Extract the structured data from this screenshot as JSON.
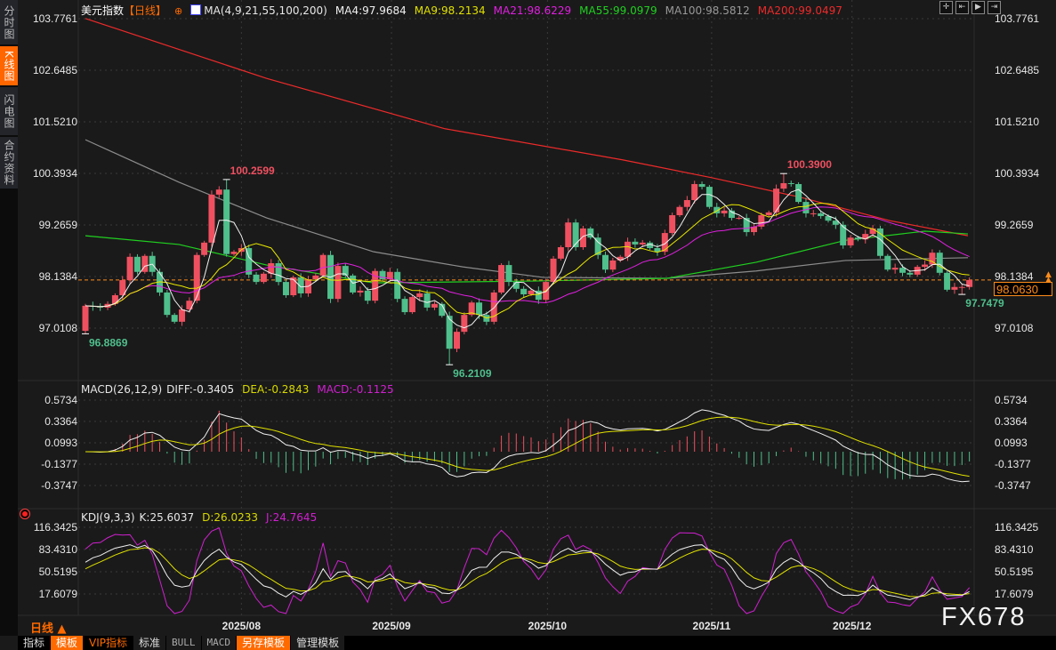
{
  "sidebar": {
    "tabs": [
      {
        "label": "分时图",
        "active": false
      },
      {
        "label": "K线图",
        "active": true
      },
      {
        "label": "闪电图",
        "active": false
      },
      {
        "label": "合约资料",
        "active": false
      }
    ]
  },
  "header": {
    "title": "美元指数",
    "period": "【日线】",
    "ma_params": "MA(4,9,21,55,100,200)",
    "ma4": "MA4:97.9684",
    "ma9": "MA9:98.2134",
    "ma21": "MA21:98.6229",
    "ma55": "MA55:99.0979",
    "ma100": "MA100:98.5812",
    "ma200": "MA200:99.0497"
  },
  "toolbar_icons": [
    "crosshair-icon",
    "zoom-start-icon",
    "play-forward-icon",
    "jump-end-icon"
  ],
  "macd_header": {
    "params": "MACD(26,12,9)",
    "diff": "DIFF:-0.3405",
    "dea": "DEA:-0.2843",
    "macd": "MACD:-0.1125"
  },
  "kdj_header": {
    "params": "KDJ(9,3,3)",
    "k": "K:25.6037",
    "d": "D:26.0233",
    "j": "J:24.7645"
  },
  "current_price": "98.0630",
  "daily_label": "日线 ▲",
  "watermark": "FX678",
  "bottom_toolbar": [
    {
      "label": "指标",
      "style": "black"
    },
    {
      "label": "模板",
      "style": "orange"
    },
    {
      "label": "VIP指标",
      "style": "vip"
    },
    {
      "label": "标准",
      "style": ""
    },
    {
      "label": "BULL",
      "style": "mono"
    },
    {
      "label": "MACD",
      "style": "mono"
    },
    {
      "label": "另存模板",
      "style": "orange"
    },
    {
      "label": "管理模板",
      "style": ""
    }
  ],
  "colors": {
    "up": "#ef5060",
    "down": "#4fbf8c",
    "ma4": "#f0f0f0",
    "ma9": "#e8e800",
    "ma21": "#e020e0",
    "ma55": "#20d020",
    "ma100": "#8c8c8c",
    "ma200": "#ee2a2a",
    "accent": "#ff6a00",
    "background": "#1a1a1a"
  },
  "chart_data": {
    "type": "candlestick",
    "price_axis": {
      "ticks": [
        "103.7761",
        "102.6485",
        "101.5210",
        "100.3934",
        "99.2659",
        "98.1384",
        "97.0108"
      ],
      "range": [
        96.1,
        103.8
      ]
    },
    "macd_axis": {
      "ticks": [
        "0.5734",
        "0.3364",
        "0.0993",
        "-0.1377",
        "-0.3747"
      ]
    },
    "kdj_axis": {
      "ticks": [
        "116.3425",
        "83.4310",
        "50.5195",
        "17.6079"
      ]
    },
    "x_ticks": [
      {
        "label": "2025/08",
        "index": 21
      },
      {
        "label": "2025/09",
        "index": 41.2
      },
      {
        "label": "2025/10",
        "index": 62.2
      },
      {
        "label": "2025/11",
        "index": 84.3
      },
      {
        "label": "2025/12",
        "index": 103.2
      }
    ],
    "first_open": 96.95,
    "closes": [
      97.5,
      97.48,
      97.46,
      97.54,
      97.73,
      98.06,
      98.57,
      98.24,
      98.59,
      98.24,
      97.79,
      97.3,
      97.15,
      97.42,
      97.61,
      98.61,
      98.88,
      99.93,
      100.04,
      98.63,
      98.68,
      98.76,
      98.18,
      98.02,
      98.2,
      98.43,
      98.02,
      97.73,
      98.12,
      97.77,
      98.08,
      98.16,
      98.61,
      97.65,
      98.37,
      98.16,
      97.79,
      97.83,
      97.61,
      98.26,
      98.08,
      98.24,
      97.65,
      97.36,
      97.69,
      97.77,
      97.46,
      97.54,
      97.28,
      96.56,
      96.93,
      97.3,
      97.57,
      97.3,
      97.15,
      97.79,
      98.39,
      98.02,
      97.87,
      97.75,
      97.83,
      97.63,
      98.02,
      98.53,
      98.78,
      99.32,
      98.78,
      99.19,
      98.99,
      98.61,
      98.29,
      98.49,
      98.57,
      98.9,
      98.84,
      98.88,
      98.76,
      98.68,
      99.09,
      99.48,
      99.66,
      99.81,
      100.16,
      100.1,
      99.66,
      99.52,
      99.58,
      99.42,
      99.42,
      99.11,
      99.23,
      99.48,
      99.54,
      100.06,
      100.18,
      100.16,
      99.77,
      99.52,
      99.52,
      99.46,
      99.36,
      99.27,
      98.82,
      98.99,
      98.95,
      99.07,
      99.19,
      98.59,
      98.29,
      98.33,
      98.22,
      98.18,
      98.35,
      98.4,
      98.66,
      98.22,
      97.85,
      97.91,
      97.91,
      98.063
    ],
    "extremes": [
      {
        "index": 0,
        "value": 96.8869,
        "type": "low",
        "label": "96.8869"
      },
      {
        "index": 19,
        "value": 100.2599,
        "type": "high",
        "label": "100.2599"
      },
      {
        "index": 49,
        "value": 96.2109,
        "type": "low",
        "label": "96.2109"
      },
      {
        "index": 94,
        "value": 100.39,
        "type": "high",
        "label": "100.3900"
      },
      {
        "index": 118,
        "value": 97.7479,
        "type": "low",
        "label": "97.7479"
      }
    ],
    "ma_lines": {
      "ma55": [
        [
          0,
          99.03
        ],
        [
          12.6,
          98.84
        ],
        [
          24.4,
          98.39
        ],
        [
          38.8,
          98.0
        ],
        [
          60.4,
          98.04
        ],
        [
          78.3,
          98.1
        ],
        [
          90.3,
          98.45
        ],
        [
          102.3,
          98.93
        ],
        [
          113.0,
          99.13
        ],
        [
          118.8,
          99.07
        ]
      ],
      "ma100": [
        [
          0,
          101.13
        ],
        [
          12.6,
          100.2
        ],
        [
          24.4,
          99.42
        ],
        [
          38.8,
          98.68
        ],
        [
          50.8,
          98.35
        ],
        [
          61.6,
          98.12
        ],
        [
          78.3,
          98.1
        ],
        [
          90.3,
          98.26
        ],
        [
          102.3,
          98.49
        ],
        [
          118.8,
          98.55
        ]
      ],
      "ma200": [
        [
          0,
          103.78
        ],
        [
          24.4,
          102.47
        ],
        [
          48.4,
          101.37
        ],
        [
          72.3,
          100.69
        ],
        [
          84.3,
          100.3
        ],
        [
          96.3,
          99.87
        ],
        [
          108.3,
          99.36
        ],
        [
          118.8,
          99.03
        ]
      ]
    }
  }
}
